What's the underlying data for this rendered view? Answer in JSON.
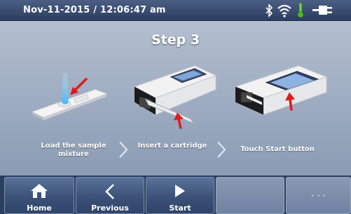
{
  "status_bar": {
    "datetime": "Nov-11-2015 / 12:06:47 am",
    "icons": [
      "bluetooth-icon",
      "wifi-icon",
      "thermometer-icon",
      "battery-plug-icon"
    ]
  },
  "step": {
    "title": "Step 3"
  },
  "steps": [
    {
      "caption_line1": "Load the sample",
      "caption_line2": "mixture",
      "image": "sample-strip-illustration"
    },
    {
      "caption_line1": "Insert a cartridge",
      "caption_line2": "",
      "image": "insert-cartridge-illustration"
    },
    {
      "caption_line1": "Touch Start button",
      "caption_line2": "",
      "image": "touch-start-illustration"
    }
  ],
  "nav": {
    "home_label": "Home",
    "previous_label": "Previous",
    "start_label": "Start",
    "more_glyph": "• • •"
  },
  "colors": {
    "status_bar": "#2c3d61",
    "background_top": "#b9c4d3",
    "arrow_red": "#e01b1b",
    "nav_button": "#3b5178"
  }
}
